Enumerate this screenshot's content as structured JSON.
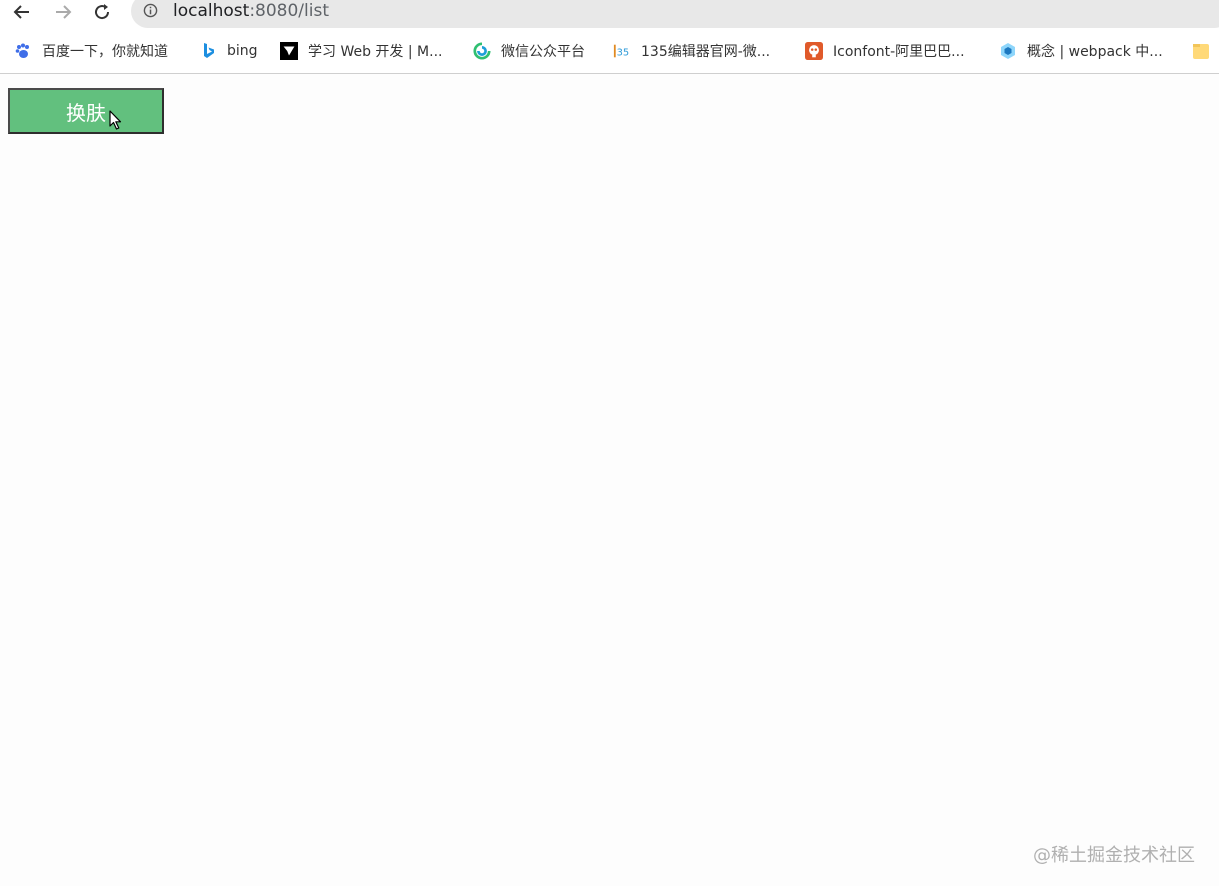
{
  "browser": {
    "url_host": "localhost",
    "url_rest": ":8080/list"
  },
  "bookmarks": [
    {
      "label": "百度一下，你就知道",
      "icon": "baidu-paw-icon"
    },
    {
      "label": "bing",
      "icon": "bing-icon"
    },
    {
      "label": "学习 Web 开发 | M...",
      "icon": "mdn-icon"
    },
    {
      "label": "微信公众平台",
      "icon": "wechat-mp-icon"
    },
    {
      "label": "135编辑器官网-微...",
      "icon": "135-editor-icon"
    },
    {
      "label": "Iconfont-阿里巴巴...",
      "icon": "iconfont-icon"
    },
    {
      "label": "概念 | webpack 中...",
      "icon": "webpack-icon"
    }
  ],
  "page": {
    "skin_button_label": "换肤"
  },
  "watermark": "@稀土掘金技术社区",
  "colors": {
    "button_bg": "#62c07e",
    "page_bg": "#fdfdfd"
  }
}
